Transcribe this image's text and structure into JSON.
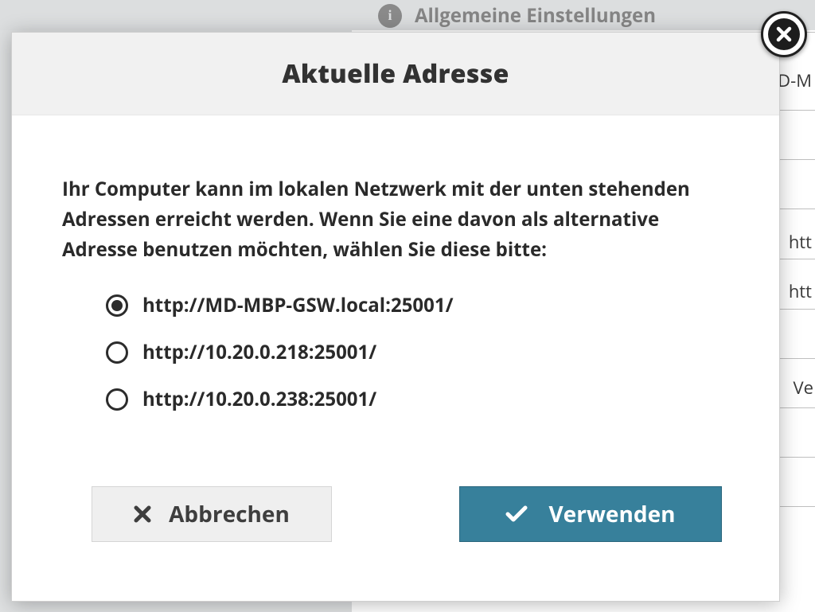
{
  "background": {
    "general_settings_label": "Allgemeine Einstellungen",
    "text_snippet_1": "D-M",
    "text_snippet_2": "htt",
    "text_snippet_3": "htt",
    "text_snippet_4": "Ve"
  },
  "modal": {
    "title": "Aktuelle Adresse",
    "description": "Ihr Computer kann im lokalen Netzwerk mit der unten stehenden Adressen erreicht werden. Wenn Sie eine davon als alternative Adresse benutzen möchten, wählen Sie diese bitte:",
    "options": [
      {
        "label": "http://MD-MBP-GSW.local:25001/",
        "selected": true
      },
      {
        "label": "http://10.20.0.218:25001/",
        "selected": false
      },
      {
        "label": "http://10.20.0.238:25001/",
        "selected": false
      }
    ],
    "cancel_label": "Abbrechen",
    "use_label": "Verwenden"
  }
}
